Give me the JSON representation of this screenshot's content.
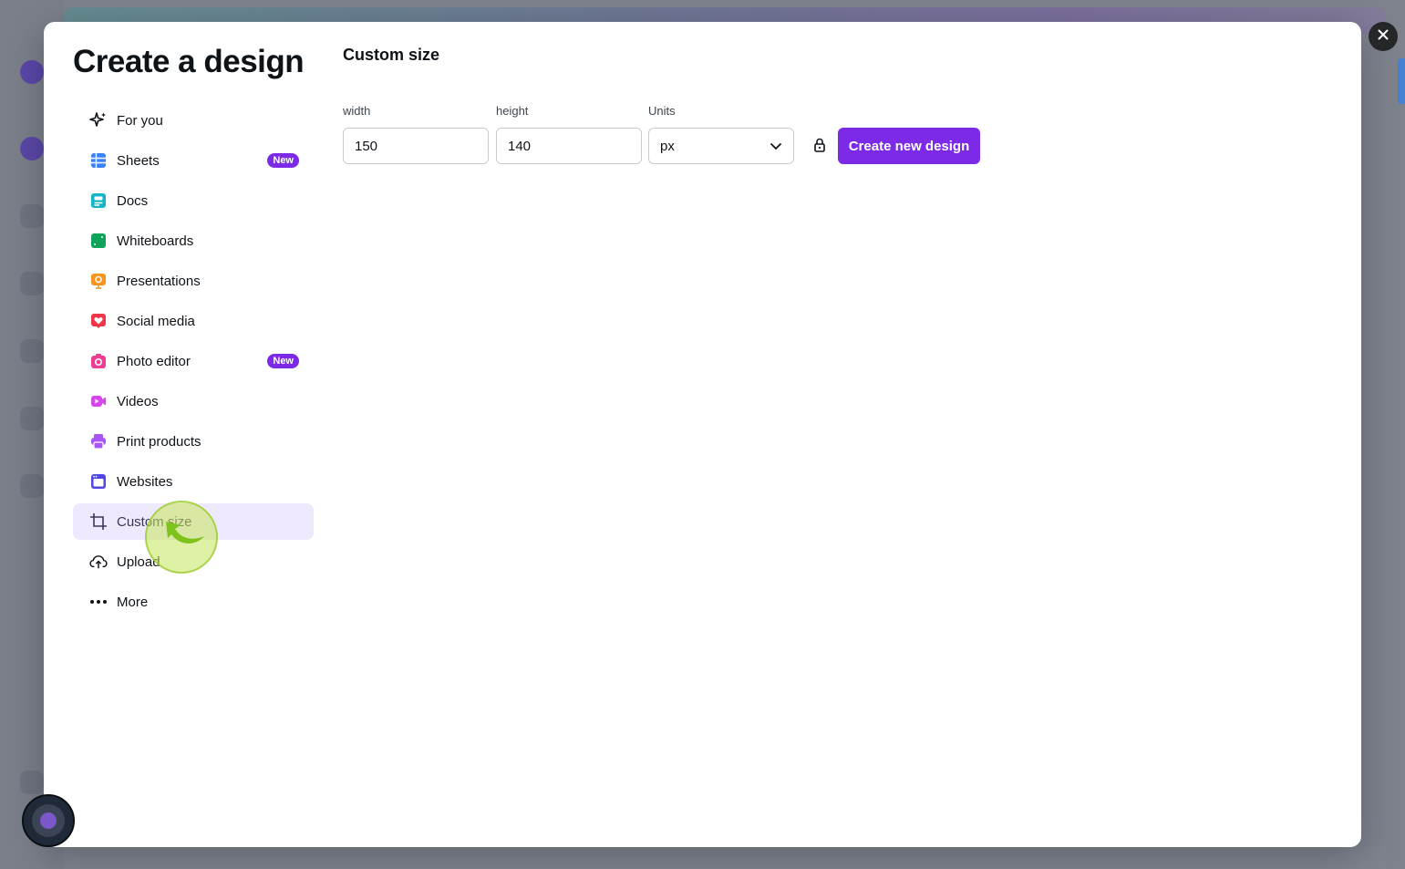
{
  "modal": {
    "title": "Create a design",
    "close_icon": "close-icon"
  },
  "sidebar": {
    "items": [
      {
        "label": "For you",
        "icon": "sparkle-icon",
        "badge": ""
      },
      {
        "label": "Sheets",
        "icon": "sheets-icon",
        "badge": "New"
      },
      {
        "label": "Docs",
        "icon": "docs-icon",
        "badge": ""
      },
      {
        "label": "Whiteboards",
        "icon": "whiteboard-icon",
        "badge": ""
      },
      {
        "label": "Presentations",
        "icon": "presentation-icon",
        "badge": ""
      },
      {
        "label": "Social media",
        "icon": "heart-icon",
        "badge": ""
      },
      {
        "label": "Photo editor",
        "icon": "camera-icon",
        "badge": "New"
      },
      {
        "label": "Videos",
        "icon": "video-icon",
        "badge": ""
      },
      {
        "label": "Print products",
        "icon": "printer-icon",
        "badge": ""
      },
      {
        "label": "Websites",
        "icon": "browser-icon",
        "badge": ""
      },
      {
        "label": "Custom size",
        "icon": "crop-icon",
        "badge": ""
      },
      {
        "label": "Upload",
        "icon": "cloud-upload-icon",
        "badge": ""
      },
      {
        "label": "More",
        "icon": "more-dots-icon",
        "badge": ""
      }
    ],
    "active": "Custom size"
  },
  "custom_size": {
    "title": "Custom size",
    "width_label": "width",
    "width_value": "150",
    "height_label": "height",
    "height_value": "140",
    "units_label": "Units",
    "units_value": "px",
    "create_button": "Create new design"
  },
  "colors": {
    "accent": "#7d2ae8",
    "active_bg": "#efe9fd"
  }
}
